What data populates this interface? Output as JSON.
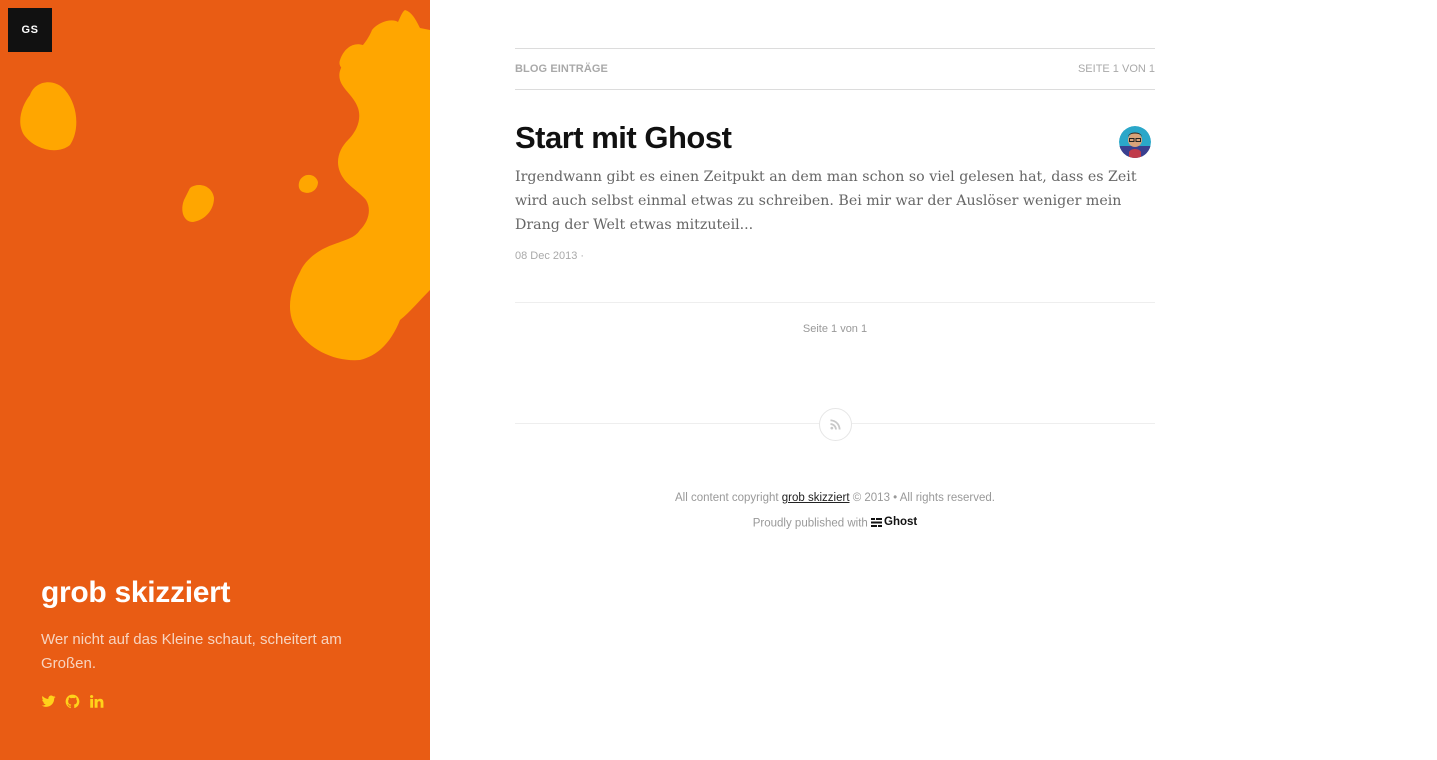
{
  "sidebar": {
    "logo_text": "GS",
    "blog_title": "grob skizziert",
    "description": "Wer nicht auf das Kleine schaut, scheitert am Großen.",
    "social": [
      "twitter-icon",
      "github-icon",
      "linkedin-icon"
    ],
    "bg_color": "#e95c14",
    "splash_color": "#ffa600",
    "icon_color": "#ffd21a"
  },
  "header": {
    "left": "BLOG EINTRÄGE",
    "right": "SEITE 1 VON 1"
  },
  "posts": [
    {
      "title": "Start mit Ghost",
      "excerpt": "Irgendwann gibt es einen Zeitpukt an dem man schon so viel gelesen hat, dass es Zeit wird auch selbst einmal etwas zu schreiben. Bei mir war der Auslöser weniger mein Drang der Welt etwas mitzuteil...",
      "date": "08 Dec 2013 ·"
    }
  ],
  "pagination": "Seite 1 von 1",
  "footer": {
    "copyright_prefix": "All content copyright",
    "copyright_link": "grob skizziert",
    "copyright_suffix": "© 2013 • All rights reserved.",
    "published_prefix": "Proudly published with",
    "ghost_label": "Ghost"
  }
}
